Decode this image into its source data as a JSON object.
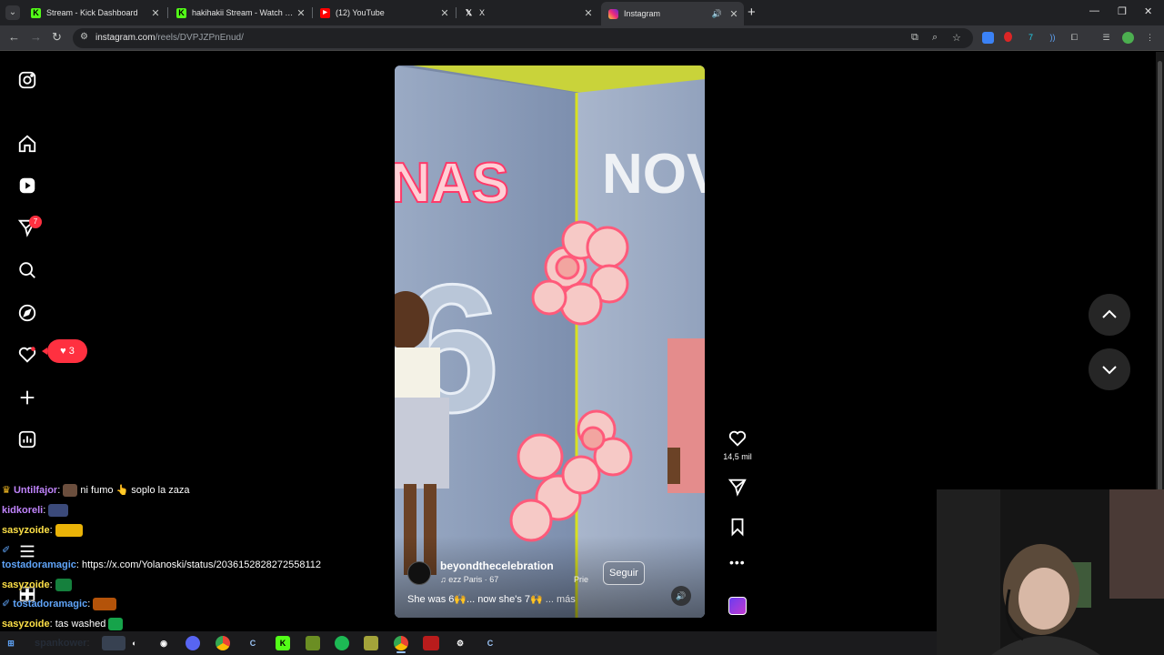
{
  "browser": {
    "tabs": [
      {
        "title": "Stream - Kick Dashboard",
        "favicon": "kick-icon"
      },
      {
        "title": "hakihakii Stream - Watch Live o",
        "favicon": "kick-icon"
      },
      {
        "title": "(12) YouTube",
        "favicon": "youtube-icon"
      },
      {
        "title": "X",
        "favicon": "x-icon"
      },
      {
        "title": "Instagram",
        "favicon": "instagram-icon"
      }
    ],
    "url_domain": "instagram.com",
    "url_path": "/reels/DVPJZPnEnud/"
  },
  "instagram": {
    "dm_badge": "7",
    "notification_count": "3",
    "reel": {
      "username": "beyondthecelebration",
      "audio": "ezz Paris · 67",
      "partial_tag": "Prie",
      "follow_label": "Seguir",
      "caption": "She was 6🙌... now she's 7🙌",
      "caption_more": "... más",
      "poster_left": "NAS",
      "poster_right": "NOV",
      "balloon_number": "6"
    },
    "actions": {
      "like_count": "14,5 mil"
    }
  },
  "chat": {
    "messages": [
      {
        "user": "Untilfajor",
        "text": "ni fumo 👆 soplo la zaza",
        "color": "#c084fc"
      },
      {
        "user": "kidkoreli",
        "text": "",
        "color": "#c084fc"
      },
      {
        "user": "sasyzoide",
        "text": "",
        "color": "#fde047"
      },
      {
        "user": "",
        "text": "",
        "color": "#fff"
      },
      {
        "user": "tostadoramagic",
        "text": "https://x.com/Yolanoski/status/2036152828272558112",
        "color": "#60a5fa"
      },
      {
        "user": "sasyzoide",
        "text": "",
        "color": "#fde047"
      },
      {
        "user": "tostadoramagic",
        "text": "",
        "color": "#60a5fa"
      },
      {
        "user": "sasyzoide",
        "text": "tas washed",
        "color": "#fde047"
      },
      {
        "user": "spankower",
        "text": "",
        "color": "#60a5fa"
      }
    ]
  },
  "colors": {
    "instagram_red": "#ff3040",
    "chrome_dark": "#202124",
    "chrome_toolbar": "#35363a"
  }
}
